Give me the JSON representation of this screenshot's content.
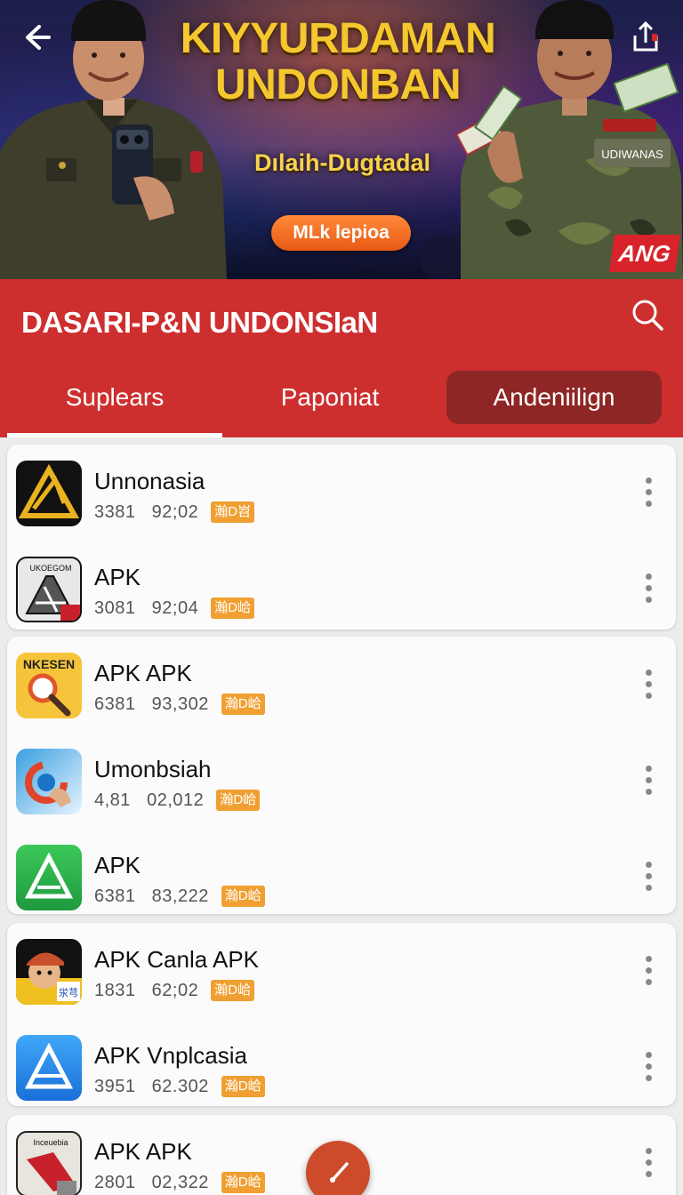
{
  "banner": {
    "title_line1": "KIYYURDAMAN",
    "title_line2": "UNDONBAN",
    "subtitle": "Dılaih-Dugtadal",
    "cta_label": "MLk lepioa",
    "badge": "ANG",
    "right_person_name_tag": "UDIWANAS"
  },
  "header": {
    "title": "DASARI-P&N UNDONSIaN",
    "search_icon": "search-icon"
  },
  "tabs": [
    {
      "label": "Suplears",
      "active": true
    },
    {
      "label": "Paponiat",
      "active": false
    },
    {
      "label": "Andeniilign",
      "active": false
    }
  ],
  "apps": [
    {
      "name": "Unnonasia",
      "meta1": "3381",
      "meta2": "92;02",
      "badge": "瀚D岧"
    },
    {
      "name": "APK",
      "meta1": "3081",
      "meta2": "92;04",
      "badge": "瀚D峆",
      "icon_text": "UKOEGOM"
    },
    {
      "name": "APK APK",
      "meta1": "6381",
      "meta2": "93,302",
      "badge": "瀚D峆",
      "icon_text": "NKESEN"
    },
    {
      "name": "Umonbsiah",
      "meta1": "4,81",
      "meta2": "02,012",
      "badge": "瀚D峆"
    },
    {
      "name": "APK",
      "meta1": "6381",
      "meta2": "83,222",
      "badge": "瀚D峆"
    },
    {
      "name": "APK Canla APK",
      "meta1": "1831",
      "meta2": "62;02",
      "badge": "瀚D峆",
      "icon_text": "泶芎"
    },
    {
      "name": "APK Vnplcasia",
      "meta1": "3951",
      "meta2": "62.302",
      "badge": "瀚D峆"
    },
    {
      "name": "APK APK",
      "meta1": "2801",
      "meta2": "02,322",
      "badge": "瀚D峆",
      "icon_text": "Inceuebia"
    }
  ],
  "colors": {
    "header_red": "#cd2f2f",
    "tab_highlight": "#8e2626",
    "badge_orange": "#f0a032",
    "title_gold": "#f4c82e"
  }
}
